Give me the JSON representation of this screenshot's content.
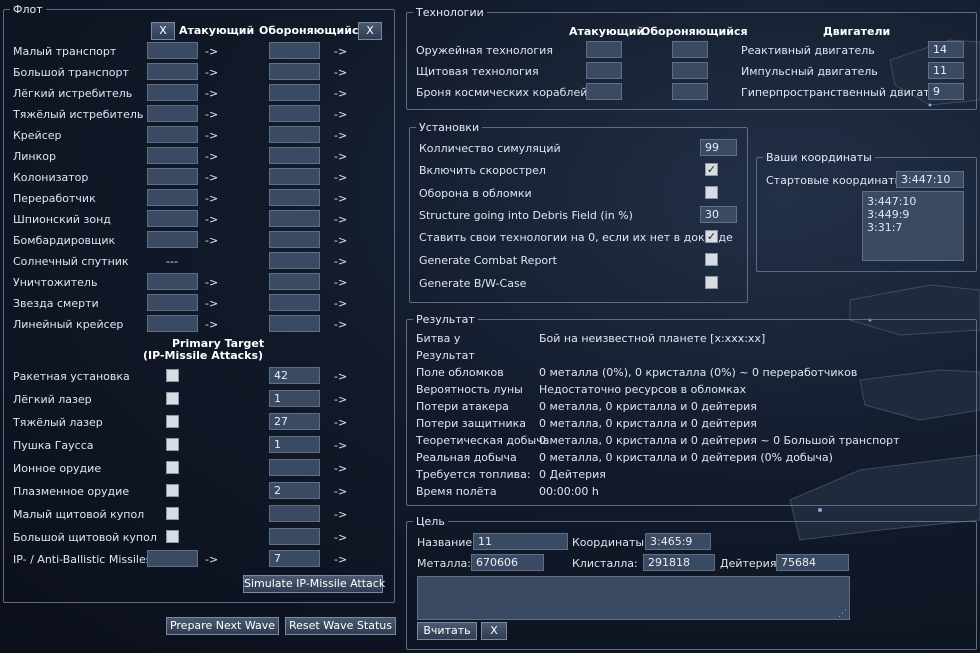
{
  "fleet": {
    "legend": "Флот",
    "clear_attacker": "X",
    "clear_defender": "X",
    "attacker_header": "Атакующий",
    "defender_header": "Обороняющийся",
    "arrow": "->",
    "ships": [
      {
        "label": "Малый транспорт",
        "att": "",
        "def": ""
      },
      {
        "label": "Большой транспорт",
        "att": "",
        "def": ""
      },
      {
        "label": "Лёгкий истребитель",
        "att": "",
        "def": ""
      },
      {
        "label": "Тяжёлый истребитель",
        "att": "",
        "def": ""
      },
      {
        "label": "Крейсер",
        "att": "",
        "def": ""
      },
      {
        "label": "Линкор",
        "att": "",
        "def": ""
      },
      {
        "label": "Колонизатор",
        "att": "",
        "def": ""
      },
      {
        "label": "Переработчик",
        "att": "",
        "def": ""
      },
      {
        "label": "Шпионский зонд",
        "att": "",
        "def": ""
      },
      {
        "label": "Бомбардировщик",
        "att": "",
        "def": ""
      },
      {
        "label": "Солнечный спутник",
        "att": "---",
        "def": ""
      },
      {
        "label": "Уничтожитель",
        "att": "",
        "def": ""
      },
      {
        "label": "Звезда смерти",
        "att": "",
        "def": ""
      },
      {
        "label": "Линейный крейсер",
        "att": "",
        "def": ""
      }
    ],
    "primary_target_line1": "Primary Target",
    "primary_target_line2": "(IP-Missile Attacks)",
    "defenses": [
      {
        "label": "Ракетная установка",
        "def": "42"
      },
      {
        "label": "Лёгкий лазер",
        "def": "1"
      },
      {
        "label": "Тяжёлый лазер",
        "def": "27"
      },
      {
        "label": "Пушка Гаусса",
        "def": "1"
      },
      {
        "label": "Ионное орудие",
        "def": ""
      },
      {
        "label": "Плазменное орудие",
        "def": "2"
      },
      {
        "label": "Малый щитовой купол",
        "def": ""
      },
      {
        "label": "Большой щитовой купол",
        "def": ""
      }
    ],
    "missiles": {
      "label": "IP- / Anti-Ballistic Missiles",
      "att": "",
      "def": "7"
    },
    "simulate_ip": "Simulate IP-Missile Attack"
  },
  "buttons": {
    "prepare_next_wave": "Prepare Next Wave",
    "reset_wave_status": "Reset Wave Status"
  },
  "tech": {
    "legend": "Технологии",
    "attacker_header": "Атакующий",
    "defender_header": "Обороняющийся",
    "engines_header": "Двигатели",
    "rows": [
      {
        "label": "Оружейная технология",
        "att": "",
        "def": ""
      },
      {
        "label": "Щитовая технология",
        "att": "",
        "def": ""
      },
      {
        "label": "Броня космических кораблей",
        "att": "",
        "def": ""
      }
    ],
    "engines": [
      {
        "label": "Реактивный двигатель",
        "value": "14"
      },
      {
        "label": "Импульсный двигатель",
        "value": "11"
      },
      {
        "label": "Гиперпространственный двигатель",
        "value": "9"
      }
    ]
  },
  "settings": {
    "legend": "Установки",
    "simulations_label": "Колличество симуляций",
    "simulations_value": "99",
    "rapidfire_label": "Включить скорострел",
    "rapidfire_checked": "✓",
    "defense_debris_label": "Оборона в обломки",
    "structure_debris_label": "Structure going into Debris Field (in %)",
    "structure_debris_value": "30",
    "zero_tech_label": "Ставить свои технологии на 0, если их нет в докладе",
    "zero_tech_checked": "✓",
    "combat_report_label": "Generate Combat Report",
    "bw_case_label": "Generate B/W-Case"
  },
  "coords": {
    "legend": "Ваши координаты",
    "start_label": "Стартовые координаты:",
    "start_value": "3:447:10",
    "list": [
      "3:447:10",
      "3:449:9",
      "3:31:7"
    ]
  },
  "result": {
    "legend": "Результат",
    "rows": [
      {
        "label": "Битва у",
        "value": "Бой на неизвестной планете [x:xxx:xx]"
      },
      {
        "label": "Результат",
        "value": ""
      },
      {
        "label": "Поле обломков",
        "value": "0 металла (0%), 0 кристалла (0%) ~ 0 переработчиков"
      },
      {
        "label": "Вероятность луны",
        "value": "Недостаточно ресурсов в обломках"
      },
      {
        "label": "Потери атакера",
        "value": "0 металла, 0 кристалла и 0 дейтерия"
      },
      {
        "label": "Потери защитника",
        "value": "0 металла, 0 кристалла и 0 дейтерия"
      },
      {
        "label": "Теоретическая добыча",
        "value": "0 металла, 0 кристалла и 0 дейтерия ~ 0 Большой транспорт"
      },
      {
        "label": "Реальная добыча",
        "value": "0 металла, 0 кристалла и 0 дейтерия (0% добыча)"
      },
      {
        "label": "Требуется топлива:",
        "value": "0 Дейтерия"
      },
      {
        "label": "Время полёта",
        "value": "00:00:00 h"
      }
    ]
  },
  "target": {
    "legend": "Цель",
    "name_label": "Название:",
    "name_value": "11",
    "coords_label": "Координаты:",
    "coords_value": "3:465:9",
    "metal_label": "Металла:",
    "metal_value": "670606",
    "crystal_label": "Клисталла:",
    "crystal_value": "291818",
    "deut_label": "Дейтерия:",
    "deut_value": "75684",
    "read_button": "Вчитать",
    "clear_button": "X"
  }
}
